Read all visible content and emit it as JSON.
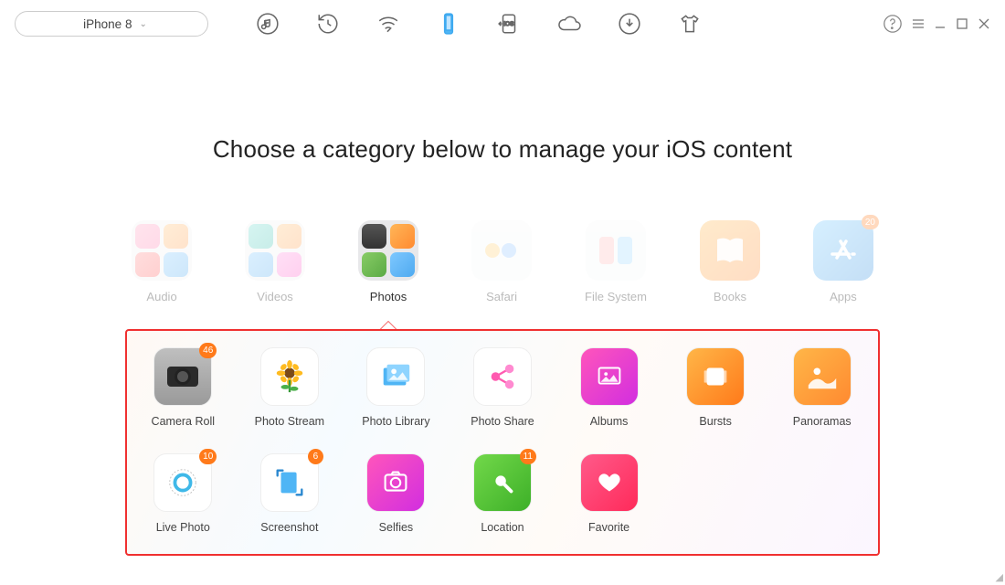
{
  "device_name": "iPhone 8",
  "heading": "Choose a category below to manage your iOS content",
  "categories": [
    {
      "key": "audio",
      "label": "Audio"
    },
    {
      "key": "videos",
      "label": "Videos"
    },
    {
      "key": "photos",
      "label": "Photos",
      "active": true
    },
    {
      "key": "safari",
      "label": "Safari"
    },
    {
      "key": "filesystem",
      "label": "File System"
    },
    {
      "key": "books",
      "label": "Books"
    },
    {
      "key": "apps",
      "label": "Apps",
      "badge": 20
    }
  ],
  "subcategories": [
    {
      "key": "camera_roll",
      "label": "Camera Roll",
      "badge": 46
    },
    {
      "key": "photo_stream",
      "label": "Photo Stream"
    },
    {
      "key": "photo_library",
      "label": "Photo Library"
    },
    {
      "key": "photo_share",
      "label": "Photo Share"
    },
    {
      "key": "albums",
      "label": "Albums"
    },
    {
      "key": "bursts",
      "label": "Bursts"
    },
    {
      "key": "panoramas",
      "label": "Panoramas"
    },
    {
      "key": "live_photo",
      "label": "Live Photo",
      "badge": 10
    },
    {
      "key": "screenshot",
      "label": "Screenshot",
      "badge": 6
    },
    {
      "key": "selfies",
      "label": "Selfies"
    },
    {
      "key": "location",
      "label": "Location",
      "badge": 11
    },
    {
      "key": "favorite",
      "label": "Favorite"
    }
  ]
}
